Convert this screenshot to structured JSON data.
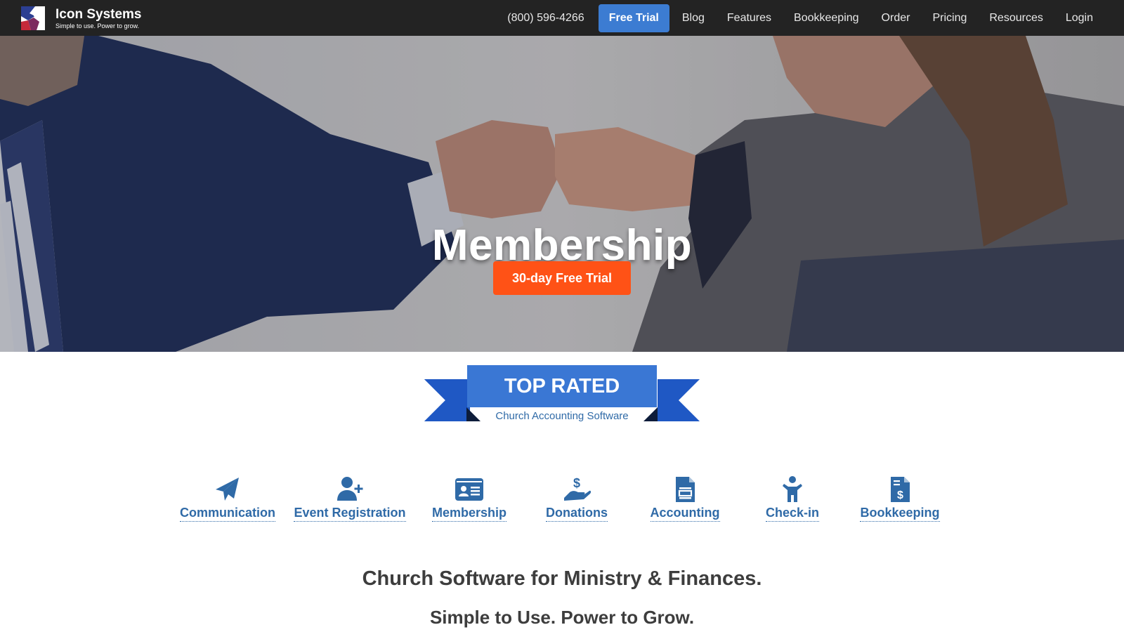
{
  "brand": {
    "name": "Icon Systems",
    "tagline": "Simple to use. Power to grow."
  },
  "nav": {
    "phone": "(800) 596-4266",
    "free_trial": "Free Trial",
    "items": [
      "Blog",
      "Features",
      "Bookkeeping",
      "Order",
      "Pricing",
      "Resources",
      "Login"
    ]
  },
  "hero": {
    "title": "Membership",
    "cta_label": "30-day Free Trial"
  },
  "ribbon": {
    "title": "TOP RATED",
    "subtitle": "Church Accounting Software"
  },
  "features": [
    {
      "label": "Communication",
      "icon": "paper-plane-icon"
    },
    {
      "label": "Event Registration",
      "icon": "user-plus-icon"
    },
    {
      "label": "Membership",
      "icon": "id-card-icon"
    },
    {
      "label": "Donations",
      "icon": "hand-dollar-icon"
    },
    {
      "label": "Accounting",
      "icon": "document-icon"
    },
    {
      "label": "Check-in",
      "icon": "child-icon"
    },
    {
      "label": "Bookkeeping",
      "icon": "invoice-dollar-icon"
    }
  ],
  "headings": {
    "main": "Church Software for Ministry & Finances.",
    "sub": "Simple to Use. Power to Grow."
  },
  "colors": {
    "topbar": "#232323",
    "nav_trial": "#3c7cd2",
    "cta": "#ff5216",
    "ribbon": "#3a77d4",
    "ribbon_tail": "#1f58c4",
    "feature": "#2f6aa7"
  }
}
